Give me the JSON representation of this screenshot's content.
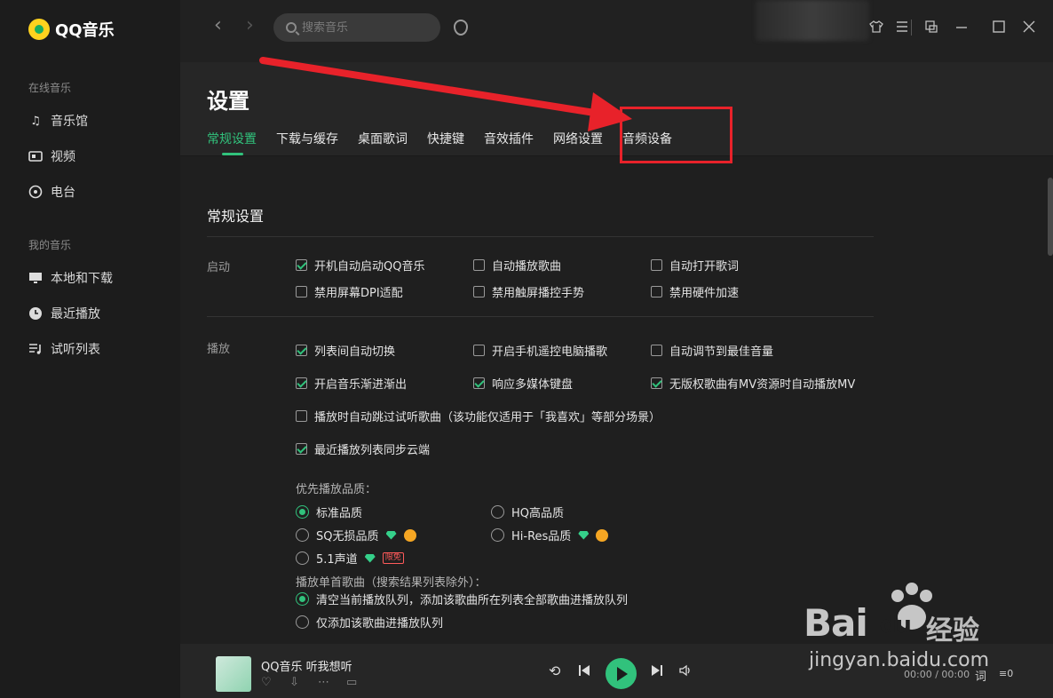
{
  "app": {
    "name": "QQ音乐"
  },
  "sidebar": {
    "group_online": "在线音乐",
    "online_items": [
      {
        "label": "音乐馆",
        "icon": "music-note-icon"
      },
      {
        "label": "视频",
        "icon": "video-icon"
      },
      {
        "label": "电台",
        "icon": "radio-icon"
      }
    ],
    "group_mine": "我的音乐",
    "mine_items": [
      {
        "label": "本地和下载",
        "icon": "monitor-icon"
      },
      {
        "label": "最近播放",
        "icon": "clock-icon"
      },
      {
        "label": "试听列表",
        "icon": "playlist-icon"
      }
    ]
  },
  "topbar": {
    "search_placeholder": "搜索音乐"
  },
  "settings": {
    "title": "设置",
    "tabs": [
      "常规设置",
      "下载与缓存",
      "桌面歌词",
      "快捷键",
      "音效插件",
      "网络设置",
      "音频设备"
    ],
    "active_tab": "常规设置",
    "section_title": "常规设置",
    "startup": {
      "label": "启动",
      "options": [
        {
          "label": "开机自动启动QQ音乐",
          "checked": true
        },
        {
          "label": "自动播放歌曲",
          "checked": false
        },
        {
          "label": "自动打开歌词",
          "checked": false
        },
        {
          "label": "禁用屏幕DPI适配",
          "checked": false
        },
        {
          "label": "禁用触屏播控手势",
          "checked": false
        },
        {
          "label": "禁用硬件加速",
          "checked": false
        }
      ]
    },
    "playback": {
      "label": "播放",
      "options": [
        {
          "label": "列表间自动切换",
          "checked": true
        },
        {
          "label": "开启手机遥控电脑播歌",
          "checked": false
        },
        {
          "label": "自动调节到最佳音量",
          "checked": false
        },
        {
          "label": "开启音乐渐进渐出",
          "checked": true
        },
        {
          "label": "响应多媒体键盘",
          "checked": true
        },
        {
          "label": "无版权歌曲有MV资源时自动播放MV",
          "checked": true
        },
        {
          "label": "播放时自动跳过试听歌曲（该功能仅适用于「我喜欢」等部分场景）",
          "checked": false
        },
        {
          "label": "最近播放列表同步云端",
          "checked": true
        }
      ],
      "quality_label": "优先播放品质：",
      "quality": [
        {
          "label": "标准品质",
          "selected": true
        },
        {
          "label": "HQ高品质",
          "selected": false
        },
        {
          "label": "SQ无损品质",
          "selected": false
        },
        {
          "label": "Hi-Res品质",
          "selected": false
        },
        {
          "label": "5.1声道",
          "selected": false,
          "tag": "限免"
        }
      ],
      "single_label": "播放单首歌曲（搜索结果列表除外）：",
      "single": [
        {
          "label": "清空当前播放队列，添加该歌曲所在列表全部歌曲进播放队列",
          "selected": true
        },
        {
          "label": "仅添加该歌曲进播放队列",
          "selected": false
        }
      ]
    }
  },
  "player": {
    "song": "QQ音乐 听我想听",
    "time": "00:00 / 00:00",
    "lyric": "词",
    "queue_count": "0"
  },
  "watermark": {
    "brand": "Bai",
    "brand2": "du",
    "jingyan": "经验",
    "url": "jingyan.baidu.com"
  },
  "colors": {
    "accent": "#31c27c",
    "annotation": "#e8222a",
    "background": "#1f1f1f"
  }
}
